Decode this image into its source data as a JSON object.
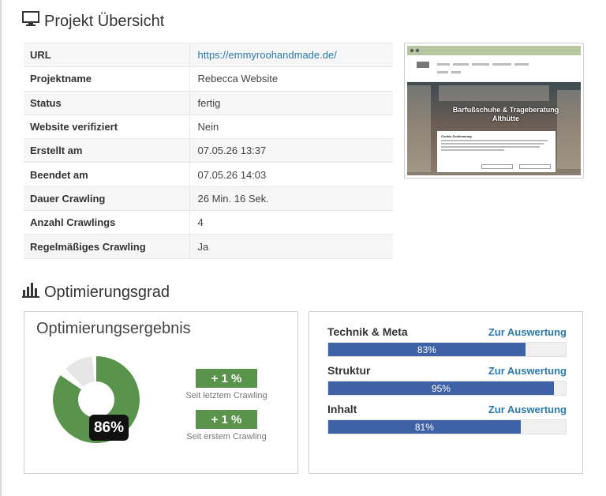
{
  "overview": {
    "title": "Projekt Übersicht",
    "rows": [
      {
        "key": "URL",
        "value": "https://emmyroohandmade.de/",
        "is_link": true
      },
      {
        "key": "Projektname",
        "value": "Rebecca Website"
      },
      {
        "key": "Status",
        "value": "fertig"
      },
      {
        "key": "Website verifiziert",
        "value": "Nein"
      },
      {
        "key": "Erstellt am",
        "value": "07.05.26 13:37"
      },
      {
        "key": "Beendet am",
        "value": "07.05.26 14:03"
      },
      {
        "key": "Dauer Crawling",
        "value": "26 Min. 16 Sek."
      },
      {
        "key": "Anzahl Crawlings",
        "value": "4"
      },
      {
        "key": "Regelmäßiges Crawling",
        "value": "Ja"
      }
    ]
  },
  "preview": {
    "hero_text": "Barfußschuhe & Trageberatung Althütte",
    "cookie_title": "Cookie-Zustimmung"
  },
  "optimization": {
    "title": "Optimierungsgrad",
    "result": {
      "title": "Optimierungsergebnis",
      "score_percent": 86,
      "score_label": "86%",
      "delta_last": "+ 1 %",
      "delta_last_label": "Seit letztem Crawling",
      "delta_first": "+ 1 %",
      "delta_first_label": "Seit erstem Crawling"
    },
    "metrics": [
      {
        "name": "Technik & Meta",
        "link": "Zur Auswertung",
        "percent": 83,
        "label": "83%"
      },
      {
        "name": "Struktur",
        "link": "Zur Auswertung",
        "percent": 95,
        "label": "95%"
      },
      {
        "name": "Inhalt",
        "link": "Zur Auswertung",
        "percent": 81,
        "label": "81%"
      }
    ]
  },
  "colors": {
    "donut_fill": "#5a934b",
    "donut_rest": "#e6e6e6",
    "bar_fill": "#3f62a6",
    "link": "#2a7ab0"
  },
  "icons": {
    "overview": "monitor-icon",
    "optimization": "bar-chart-icon"
  }
}
